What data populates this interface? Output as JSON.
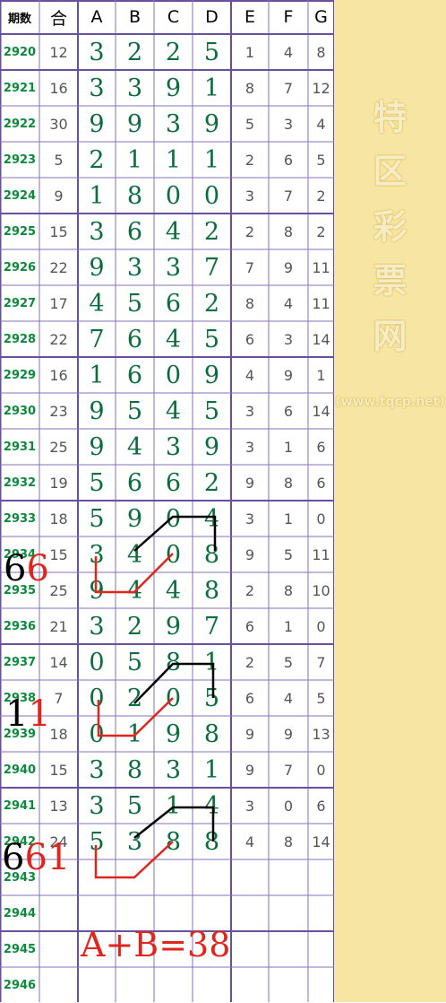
{
  "header": {
    "issue": "期数",
    "sum": "合",
    "cols": [
      "A",
      "B",
      "C",
      "D",
      "E",
      "F",
      "G"
    ]
  },
  "rows": [
    {
      "issue": "2920",
      "sum": "12",
      "big": [
        "3",
        "2",
        "2",
        "5"
      ],
      "small": [
        "1",
        "4",
        "8"
      ]
    },
    {
      "issue": "2921",
      "sum": "16",
      "big": [
        "3",
        "3",
        "9",
        "1"
      ],
      "small": [
        "8",
        "7",
        "12"
      ]
    },
    {
      "issue": "2922",
      "sum": "30",
      "big": [
        "9",
        "9",
        "3",
        "9"
      ],
      "small": [
        "5",
        "3",
        "4"
      ]
    },
    {
      "issue": "2923",
      "sum": "5",
      "big": [
        "2",
        "1",
        "1",
        "1"
      ],
      "small": [
        "2",
        "6",
        "5"
      ]
    },
    {
      "issue": "2924",
      "sum": "9",
      "big": [
        "1",
        "8",
        "0",
        "0"
      ],
      "small": [
        "3",
        "7",
        "2"
      ]
    },
    {
      "issue": "2925",
      "sum": "15",
      "big": [
        "3",
        "6",
        "4",
        "2"
      ],
      "small": [
        "2",
        "8",
        "2"
      ]
    },
    {
      "issue": "2926",
      "sum": "22",
      "big": [
        "9",
        "3",
        "3",
        "7"
      ],
      "small": [
        "7",
        "9",
        "11"
      ]
    },
    {
      "issue": "2927",
      "sum": "17",
      "big": [
        "4",
        "5",
        "6",
        "2"
      ],
      "small": [
        "8",
        "4",
        "11"
      ]
    },
    {
      "issue": "2928",
      "sum": "22",
      "big": [
        "7",
        "6",
        "4",
        "5"
      ],
      "small": [
        "6",
        "3",
        "14"
      ]
    },
    {
      "issue": "2929",
      "sum": "16",
      "big": [
        "1",
        "6",
        "0",
        "9"
      ],
      "small": [
        "4",
        "9",
        "1"
      ]
    },
    {
      "issue": "2930",
      "sum": "23",
      "big": [
        "9",
        "5",
        "4",
        "5"
      ],
      "small": [
        "3",
        "6",
        "14"
      ]
    },
    {
      "issue": "2931",
      "sum": "25",
      "big": [
        "9",
        "4",
        "3",
        "9"
      ],
      "small": [
        "3",
        "1",
        "6"
      ]
    },
    {
      "issue": "2932",
      "sum": "19",
      "big": [
        "5",
        "6",
        "6",
        "2"
      ],
      "small": [
        "9",
        "8",
        "6"
      ]
    },
    {
      "issue": "2933",
      "sum": "18",
      "big": [
        "5",
        "9",
        "0",
        "4"
      ],
      "small": [
        "3",
        "1",
        "0"
      ]
    },
    {
      "issue": "2934",
      "sum": "15",
      "big": [
        "3",
        "4",
        "0",
        "8"
      ],
      "small": [
        "9",
        "5",
        "11"
      ]
    },
    {
      "issue": "2935",
      "sum": "25",
      "big": [
        "9",
        "4",
        "4",
        "8"
      ],
      "small": [
        "2",
        "8",
        "10"
      ]
    },
    {
      "issue": "2936",
      "sum": "21",
      "big": [
        "3",
        "2",
        "9",
        "7"
      ],
      "small": [
        "6",
        "1",
        "0"
      ]
    },
    {
      "issue": "2937",
      "sum": "14",
      "big": [
        "0",
        "5",
        "8",
        "1"
      ],
      "small": [
        "2",
        "5",
        "7"
      ]
    },
    {
      "issue": "2938",
      "sum": "7",
      "big": [
        "0",
        "2",
        "0",
        "5"
      ],
      "small": [
        "6",
        "4",
        "5"
      ]
    },
    {
      "issue": "2939",
      "sum": "18",
      "big": [
        "0",
        "1",
        "9",
        "8"
      ],
      "small": [
        "9",
        "9",
        "13"
      ]
    },
    {
      "issue": "2940",
      "sum": "15",
      "big": [
        "3",
        "8",
        "3",
        "1"
      ],
      "small": [
        "9",
        "7",
        "0"
      ]
    },
    {
      "issue": "2941",
      "sum": "13",
      "big": [
        "3",
        "5",
        "1",
        "4"
      ],
      "small": [
        "3",
        "0",
        "6"
      ]
    },
    {
      "issue": "2942",
      "sum": "24",
      "big": [
        "5",
        "3",
        "8",
        "8"
      ],
      "small": [
        "4",
        "8",
        "14"
      ]
    },
    {
      "issue": "2943",
      "sum": "",
      "big": [
        "",
        "",
        "",
        ""
      ],
      "small": [
        "",
        "",
        ""
      ]
    },
    {
      "issue": "2944",
      "sum": "",
      "big": [
        "",
        "",
        "",
        ""
      ],
      "small": [
        "",
        "",
        ""
      ]
    },
    {
      "issue": "2945",
      "sum": "",
      "big": [
        "",
        "",
        "",
        ""
      ],
      "small": [
        "",
        "",
        ""
      ]
    },
    {
      "issue": "2946",
      "sum": "",
      "big": [
        "",
        "",
        "",
        ""
      ],
      "small": [
        "",
        "",
        ""
      ]
    }
  ],
  "annotations": [
    {
      "black": "6",
      "red": "6"
    },
    {
      "black": "1",
      "red": "1"
    },
    {
      "black": "6",
      "red": "61"
    }
  ],
  "formula": "A+B=38",
  "watermark": {
    "chars": [
      "特",
      "区",
      "彩",
      "票",
      "网"
    ],
    "url": "(www.tqcp.net)"
  },
  "colors": {
    "grid_line": "#8a6fb8",
    "group_line": "#6a4fa0",
    "issue_text": "#0a8a3a",
    "big_digit": "#0a6e3c",
    "small_digit": "#555555",
    "side_panel": "#f7e6a3",
    "annotation_red": "#e0261c",
    "annotation_black": "#000000"
  }
}
